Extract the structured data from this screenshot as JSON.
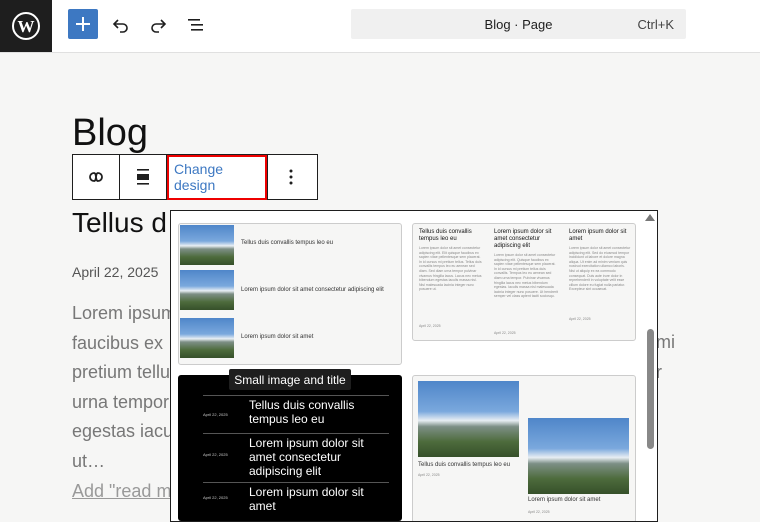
{
  "topbar": {
    "logo_icon": "wordpress-logo-icon",
    "add_icon": "plus-icon",
    "undo_icon": "undo-icon",
    "redo_icon": "redo-icon",
    "outline_icon": "document-overview-icon",
    "command_title": "Blog · Page",
    "command_shortcut": "Ctrl+K",
    "accent": "#3d78c2"
  },
  "page": {
    "title": "Blog",
    "toolbar": {
      "link_icon": "link-icon",
      "align_icon": "align-icon",
      "change_design_label": "Change design",
      "more_icon": "more-vertical-icon",
      "highlight_color": "#e00000"
    },
    "post_heading": "Tellus d",
    "post_date": "April 22, 2025",
    "excerpt_lines": [
      "Lorem ipsum",
      "faucibus ex",
      "pretium tellu",
      "urna tempor",
      "egestas iacu",
      "ut…"
    ],
    "excerpt_right": [
      "mi",
      "r"
    ],
    "read_more": "Add \"read m"
  },
  "design_popover": {
    "tooltip": "Small image and title",
    "card1": {
      "items": [
        "Tellus duis convallis tempus leo eu",
        "Lorem ipsum dolor sit amet consectetur adipiscing elit",
        "Lorem ipsum dolor sit amet"
      ]
    },
    "card2": {
      "columns": [
        {
          "title": "Tellus duis convallis tempus leo eu",
          "text": "Lorem ipsum dolor sit amet consectetur adipiscing elit. Elit quisque faucibus ex sapien vitae pellentesque sem placerat. In id cursus mi pretium tellus. Tellus duis convallis tempus leo eu aenean sed diam. Sed diam urna tempor pulvinar vivamus fringilla lacus. Lacus nec metus bibendum egestas iaculis massa nisl. Nisl malesuada lacinia integer nunc posuere ut.",
          "date": "April 22, 2025"
        },
        {
          "title": "Lorem ipsum dolor sit amet consectetur adipiscing elit",
          "text": "Lorem ipsum dolor sit amet consectetur adipiscing elit. Quisque faucibus ex sapien vitae pellentesque sem placerat. In id cursus mi pretium tellus duis convallis. Tempus leo eu aenean sed diam urna tempor. Pulvinar vivamus fringilla lacus nec metus bibendum egestas. Iaculis massa nisl malesuada lacinia integer nunc posuere. Ut hendrerit semper vel class aptent taciti sociosqu.",
          "date": "April 22, 2025"
        },
        {
          "title": "Lorem ipsum dolor sit amet",
          "text": "Lorem ipsum dolor sit amet consectetur adipiscing elit. Sed do eiusmod tempor incididunt ut labore et dolore magna aliqua. Ut enim ad minim veniam quis nostrud exercitation ullamco laboris. Nisi ut aliquip ex ea commodo consequat. Duis aute irure dolor in reprehenderit in voluptate velit esse cillum dolore eu fugiat nulla pariatur. Excepteur sint occaecat.",
          "date": "April 22, 2025"
        }
      ]
    },
    "card3": {
      "items": [
        {
          "date": "April 22, 2025",
          "title": "Tellus duis convallis tempus leo eu"
        },
        {
          "date": "April 22, 2025",
          "title": "Lorem ipsum dolor sit amet consectetur adipiscing elit"
        },
        {
          "date": "April 22, 2025",
          "title": "Lorem ipsum dolor sit amet"
        }
      ]
    },
    "card4": {
      "items": [
        {
          "title": "Tellus duis convallis tempus leo eu",
          "date": "April 22, 2025"
        },
        {
          "title": "Lorem ipsum dolor sit amet",
          "date": "April 22, 2025"
        }
      ]
    }
  }
}
